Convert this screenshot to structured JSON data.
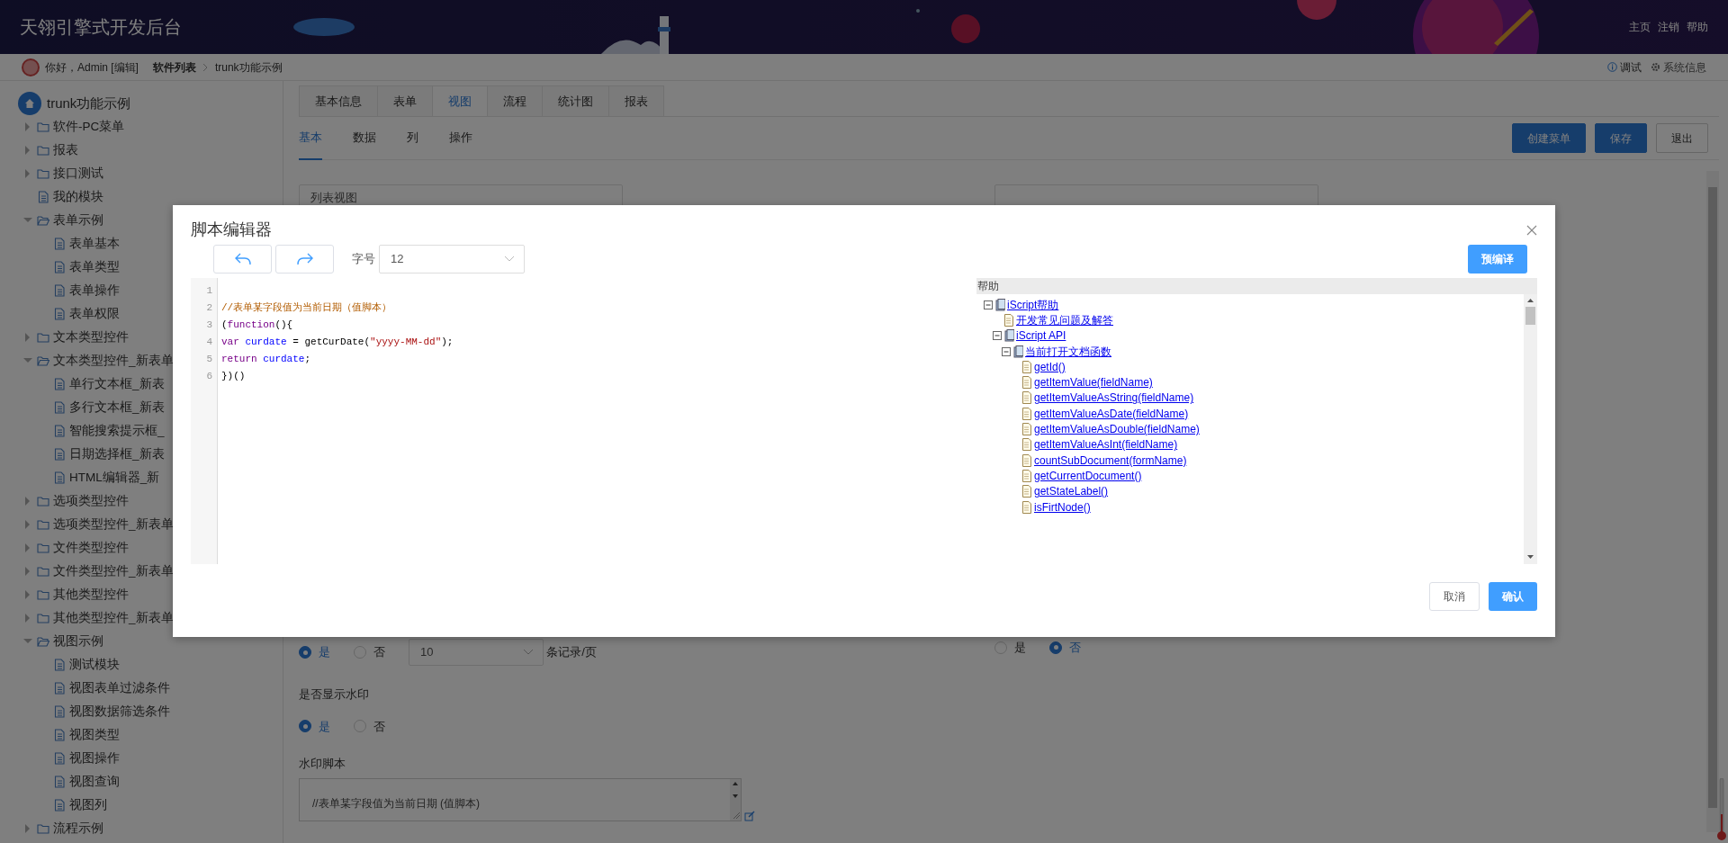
{
  "header": {
    "title": "天翎引擎式开发后台",
    "links": [
      "主页",
      "注销",
      "帮助"
    ]
  },
  "breadcrumb": {
    "greeting": "你好，Admin",
    "edit_link": "[编辑]",
    "items": [
      {
        "label": "软件列表",
        "bold": true
      },
      {
        "label": "trunk功能示例",
        "bold": false
      }
    ],
    "actions": [
      {
        "kind": "info",
        "label": "调试"
      },
      {
        "kind": "gear",
        "label": "系统信息"
      }
    ]
  },
  "sidebar": {
    "root": "trunk功能示例",
    "items": [
      {
        "label": "软件-PC菜单",
        "kind": "folder",
        "expanded": false
      },
      {
        "label": "报表",
        "kind": "folder",
        "expanded": false
      },
      {
        "label": "接口测试",
        "kind": "folder",
        "expanded": false
      },
      {
        "label": "我的模块",
        "kind": "file"
      },
      {
        "label": "表单示例",
        "kind": "folder",
        "expanded": true,
        "children": [
          {
            "label": "表单基本",
            "kind": "file"
          },
          {
            "label": "表单类型",
            "kind": "file"
          },
          {
            "label": "表单操作",
            "kind": "file"
          },
          {
            "label": "表单权限",
            "kind": "file"
          }
        ]
      },
      {
        "label": "文本类型控件",
        "kind": "folder",
        "expanded": false
      },
      {
        "label": "文本类型控件_新表单",
        "kind": "folder",
        "expanded": true,
        "children": [
          {
            "label": "单行文本框_新表",
            "kind": "file"
          },
          {
            "label": "多行文本框_新表",
            "kind": "file"
          },
          {
            "label": "智能搜索提示框_",
            "kind": "file"
          },
          {
            "label": "日期选择框_新表",
            "kind": "file"
          },
          {
            "label": "HTML编辑器_新",
            "kind": "file"
          }
        ]
      },
      {
        "label": "选项类型控件",
        "kind": "folder",
        "expanded": false
      },
      {
        "label": "选项类型控件_新表单",
        "kind": "folder",
        "expanded": false
      },
      {
        "label": "文件类型控件",
        "kind": "folder",
        "expanded": false
      },
      {
        "label": "文件类型控件_新表单",
        "kind": "folder",
        "expanded": false
      },
      {
        "label": "其他类型控件",
        "kind": "folder",
        "expanded": false
      },
      {
        "label": "其他类型控件_新表单",
        "kind": "folder",
        "expanded": false
      },
      {
        "label": "视图示例",
        "kind": "folder",
        "expanded": true,
        "children": [
          {
            "label": "测试模块",
            "kind": "file"
          },
          {
            "label": "视图表单过滤条件",
            "kind": "file"
          },
          {
            "label": "视图数据筛选条件",
            "kind": "file"
          },
          {
            "label": "视图类型",
            "kind": "file"
          },
          {
            "label": "视图操作",
            "kind": "file"
          },
          {
            "label": "视图查询",
            "kind": "file"
          },
          {
            "label": "视图列",
            "kind": "file"
          }
        ]
      },
      {
        "label": "流程示例",
        "kind": "folder",
        "expanded": false
      }
    ]
  },
  "content": {
    "tabs": [
      {
        "label": "基本信息",
        "selected": false
      },
      {
        "label": "表单",
        "selected": false
      },
      {
        "label": "视图",
        "selected": true
      },
      {
        "label": "流程",
        "selected": false
      },
      {
        "label": "统计图",
        "selected": false
      },
      {
        "label": "报表",
        "selected": false
      }
    ],
    "subtabs": [
      {
        "label": "基本",
        "selected": true
      },
      {
        "label": "数据",
        "selected": false
      },
      {
        "label": "列",
        "selected": false
      },
      {
        "label": "操作",
        "selected": false
      }
    ],
    "buttons": [
      {
        "label": "创建菜单",
        "kind": "primary"
      },
      {
        "label": "保存",
        "kind": "primary"
      },
      {
        "label": "退出",
        "kind": "default"
      }
    ],
    "fields": [
      {
        "kind": "filled",
        "value": "列表视图"
      },
      {
        "kind": "blank"
      }
    ],
    "paging": {
      "radios": [
        {
          "label": "是",
          "selected": true
        },
        {
          "label": "否",
          "selected": false
        }
      ],
      "page_size": "10",
      "unit": "条记录/页"
    },
    "right_radios": [
      {
        "label": "是",
        "selected": false
      },
      {
        "label": "否",
        "selected": true
      }
    ],
    "watermark": {
      "label": "是否显示水印",
      "radios": [
        {
          "label": "是",
          "selected": true
        },
        {
          "label": "否",
          "selected": false
        }
      ]
    },
    "watermark_script": {
      "label": "水印脚本",
      "value": "//表单某字段值为当前日期 (值脚本)"
    }
  },
  "dialog": {
    "title": "脚本编辑器",
    "font_size_label": "字号",
    "font_size": "12",
    "precompile": "预编译",
    "code": [
      {
        "number": "1"
      },
      {
        "number": "2",
        "tokens": [
          {
            "kind": "comment",
            "text": "//表单某字段值为当前日期（值脚本）"
          }
        ]
      },
      {
        "number": "3",
        "tokens": [
          {
            "kind": "plain",
            "text": "("
          },
          {
            "kind": "keyword",
            "text": "function"
          },
          {
            "kind": "plain",
            "text": "(){"
          }
        ]
      },
      {
        "number": "4",
        "tokens": [
          {
            "kind": "keyword",
            "text": "var "
          },
          {
            "kind": "variable",
            "text": "curdate"
          },
          {
            "kind": "plain",
            "text": " = getCurDate("
          },
          {
            "kind": "string",
            "text": "\"yyyy-MM-dd\""
          },
          {
            "kind": "plain",
            "text": ");"
          }
        ]
      },
      {
        "number": "5",
        "tokens": [
          {
            "kind": "keyword",
            "text": "return "
          },
          {
            "kind": "variable",
            "text": "curdate"
          },
          {
            "kind": "plain",
            "text": ";"
          }
        ]
      },
      {
        "number": "6",
        "tokens": [
          {
            "kind": "plain",
            "text": "})()"
          }
        ]
      }
    ],
    "help": {
      "title": "帮助",
      "tree": [
        {
          "label": "iScript帮助",
          "kind": "book",
          "expanded": true,
          "children": [
            {
              "label": "开发常见问题及解答",
              "kind": "page"
            },
            {
              "label": "iScript API",
              "kind": "book",
              "expanded": true,
              "children": [
                {
                  "label": "当前打开文档函数",
                  "kind": "book",
                  "expanded": true,
                  "children": [
                    {
                      "label": "getId()",
                      "kind": "page"
                    },
                    {
                      "label": "getItemValue(fieldName)",
                      "kind": "page"
                    },
                    {
                      "label": "getItemValueAsString(fieldName)",
                      "kind": "page"
                    },
                    {
                      "label": "getItemValueAsDate(fieldName)",
                      "kind": "page"
                    },
                    {
                      "label": "getItemValueAsDouble(fieldName)",
                      "kind": "page"
                    },
                    {
                      "label": "getItemValueAsInt(fieldName)",
                      "kind": "page"
                    },
                    {
                      "label": "countSubDocument(formName)",
                      "kind": "page"
                    },
                    {
                      "label": "getCurrentDocument()",
                      "kind": "page"
                    },
                    {
                      "label": "getStateLabel()",
                      "kind": "page"
                    },
                    {
                      "label": "isFirtNode()",
                      "kind": "page"
                    }
                  ]
                }
              ]
            }
          ]
        }
      ]
    },
    "buttons": [
      {
        "label": "取消",
        "kind": "default"
      },
      {
        "label": "确认",
        "kind": "primary"
      }
    ]
  }
}
